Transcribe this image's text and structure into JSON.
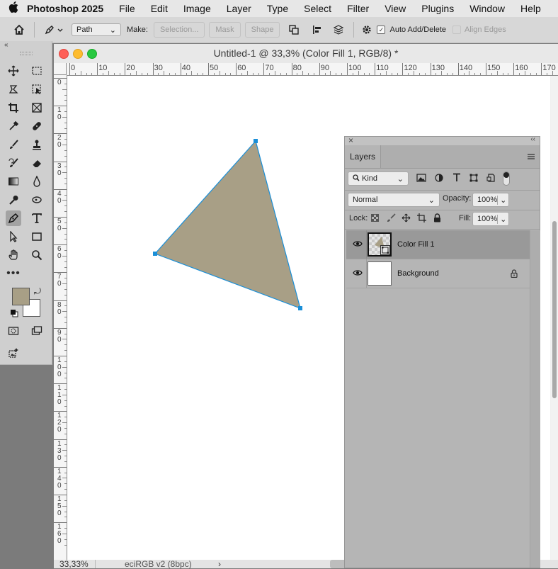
{
  "menubar": {
    "app_name": "Photoshop 2025",
    "items": [
      "File",
      "Edit",
      "Image",
      "Layer",
      "Type",
      "Select",
      "Filter",
      "View",
      "Plugins",
      "Window",
      "Help"
    ]
  },
  "options_bar": {
    "mode_value": "Path",
    "make_label": "Make:",
    "selection_label": "Selection...",
    "mask_label": "Mask",
    "shape_label": "Shape",
    "auto_add_delete_label": "Auto Add/Delete",
    "auto_add_delete_checked": true,
    "align_edges_label": "Align Edges",
    "align_edges_checked": false
  },
  "document": {
    "title": "Untitled-1 @ 33,3% (Color Fill 1, RGB/8) *",
    "h_ruler_ticks": [
      "0",
      "10",
      "20",
      "30",
      "40",
      "50",
      "60",
      "70",
      "80",
      "90",
      "100",
      "110",
      "120",
      "130",
      "140",
      "150",
      "160",
      "170"
    ],
    "v_ruler_ticks": [
      "0",
      "1\n0",
      "2\n0",
      "3\n0",
      "4\n0",
      "5\n0",
      "6\n0",
      "7\n0",
      "8\n0",
      "9\n0",
      "1\n0\n0",
      "1\n1\n0",
      "1\n2\n0",
      "1\n3\n0",
      "1\n4\n0",
      "1\n5\n0",
      "1\n6\n0"
    ],
    "zoom": "33,33%",
    "color_profile": "eciRGB v2 (8bpc)",
    "status_arrow": "›",
    "shape_fill": "#a89f86",
    "path_color": "#1a8fd8"
  },
  "tools": {
    "foreground_color": "#a89f86",
    "background_color": "#ffffff"
  },
  "layers_panel": {
    "tab_label": "Layers",
    "filter_kind": "Kind",
    "blend_mode": "Normal",
    "opacity_label": "Opacity:",
    "opacity_value": "100%",
    "lock_label": "Lock:",
    "fill_label": "Fill:",
    "fill_value": "100%",
    "layers": [
      {
        "name": "Color Fill 1",
        "selected": true
      },
      {
        "name": "Background",
        "selected": false
      }
    ]
  }
}
